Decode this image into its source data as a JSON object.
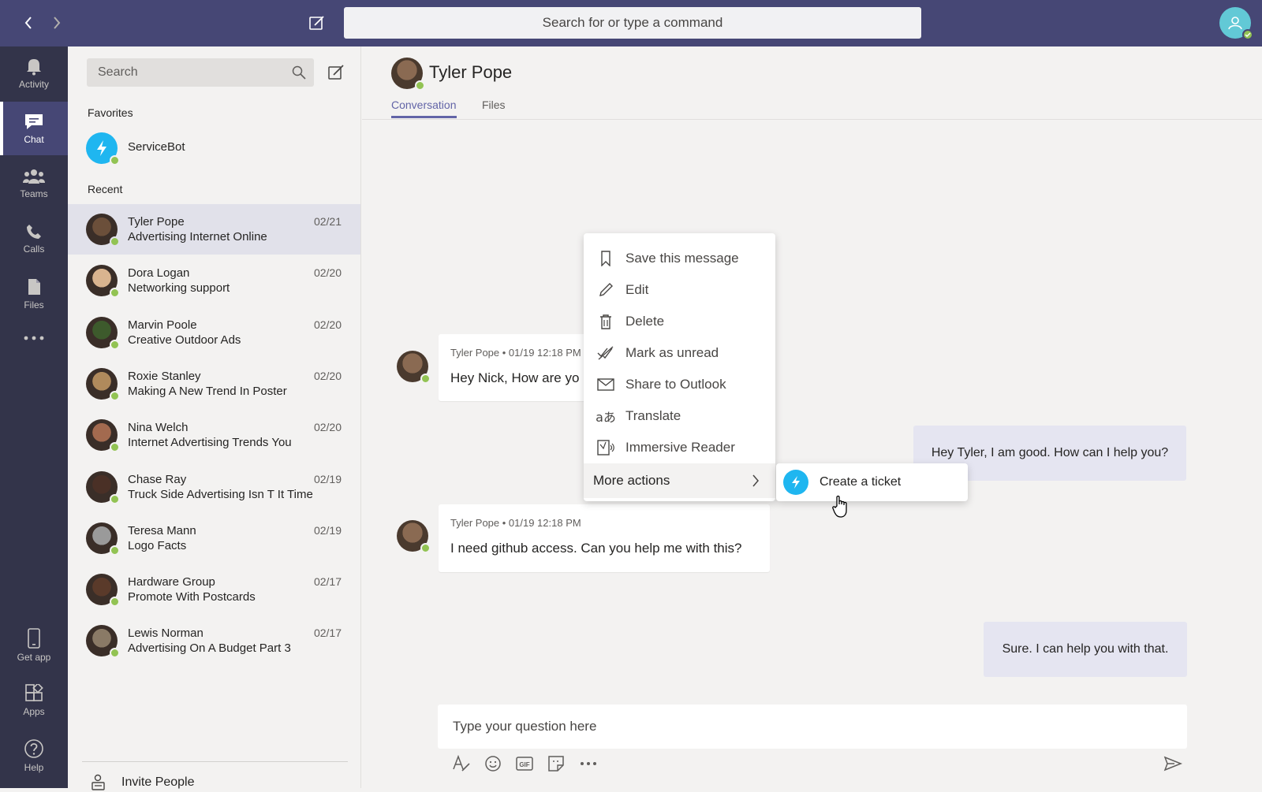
{
  "topbar": {
    "search_placeholder": "Search for or type a command"
  },
  "rail": {
    "items": [
      {
        "label": "Activity",
        "icon": "bell-icon"
      },
      {
        "label": "Chat",
        "icon": "chat-icon"
      },
      {
        "label": "Teams",
        "icon": "teams-icon"
      },
      {
        "label": "Calls",
        "icon": "phone-icon"
      },
      {
        "label": "Files",
        "icon": "files-icon"
      },
      {
        "label": "Get app",
        "icon": "mobile-icon"
      },
      {
        "label": "Apps",
        "icon": "apps-icon"
      },
      {
        "label": "Help",
        "icon": "help-icon"
      }
    ],
    "active": "Chat"
  },
  "chatlist": {
    "search_placeholder": "Search",
    "favorites_label": "Favorites",
    "favorites": [
      {
        "name": "ServiceBot"
      }
    ],
    "recent_label": "Recent",
    "recent": [
      {
        "name": "Tyler Pope",
        "preview": "Advertising Internet Online",
        "date": "02/21",
        "color": "#6b4f3a"
      },
      {
        "name": "Dora Logan",
        "preview": "Networking support",
        "date": "02/20",
        "color": "#d9b48f"
      },
      {
        "name": "Marvin Poole",
        "preview": "Creative Outdoor Ads",
        "date": "02/20",
        "color": "#3d5a2c"
      },
      {
        "name": "Roxie Stanley",
        "preview": "Making A New Trend In Poster",
        "date": "02/20",
        "color": "#b08a5c"
      },
      {
        "name": "Nina Welch",
        "preview": "Internet Advertising Trends You",
        "date": "02/20",
        "color": "#a36a4f"
      },
      {
        "name": "Chase Ray",
        "preview": "Truck Side Advertising Isn T It Time",
        "date": "02/19",
        "color": "#4a3026"
      },
      {
        "name": "Teresa Mann",
        "preview": "Logo Facts",
        "date": "02/19",
        "color": "#9a9a9a"
      },
      {
        "name": "Hardware Group",
        "preview": "Promote With Postcards",
        "date": "02/17",
        "color": "#5a3a2a"
      },
      {
        "name": "Lewis Norman",
        "preview": "Advertising On A Budget Part 3",
        "date": "02/17",
        "color": "#8a7a66"
      }
    ],
    "invite_label": "Invite People"
  },
  "conversation": {
    "title": "Tyler Pope",
    "tabs": [
      "Conversation",
      "Files"
    ],
    "messages": [
      {
        "meta": "Tyler Pope • 01/19 12:18 PM",
        "text": "Hey Nick, How are yo"
      },
      {
        "text": "Hey Tyler, I am good. How can I help you?"
      },
      {
        "meta": "Tyler Pope • 01/19 12:18 PM",
        "text": "I need github access. Can you help me with this?"
      },
      {
        "text": "Sure. I can help you with that."
      }
    ],
    "composer_placeholder": "Type your question here"
  },
  "context_menu": {
    "items": [
      {
        "label": "Save this message",
        "icon": "bookmark-icon"
      },
      {
        "label": "Edit",
        "icon": "pencil-icon"
      },
      {
        "label": "Delete",
        "icon": "trash-icon"
      },
      {
        "label": "Mark as unread",
        "icon": "unread-icon"
      },
      {
        "label": "Share to Outlook",
        "icon": "mail-icon"
      },
      {
        "label": "Translate",
        "icon": "translate-icon"
      },
      {
        "label": "Immersive Reader",
        "icon": "reader-icon"
      }
    ],
    "more_actions_label": "More actions",
    "submenu": {
      "label": "Create a ticket"
    }
  },
  "colors": {
    "topbar": "#464775",
    "rail": "#33344a",
    "accent": "#6264a7",
    "online": "#92c353",
    "bot": "#1fb6f0"
  }
}
